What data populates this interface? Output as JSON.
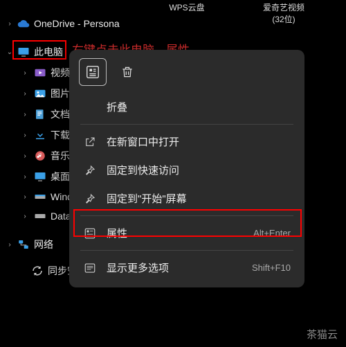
{
  "top_icons": {
    "wps": "WPS云盘",
    "iqiyi": "爱奇艺视频 (32位)"
  },
  "sidebar": {
    "onedrive": "OneDrive - Persona",
    "this_pc": "此电脑",
    "videos": "视频",
    "pictures": "图片",
    "documents": "文档",
    "downloads": "下载",
    "music": "音乐",
    "desktop": "桌面",
    "wind": "Wind",
    "data": "Data",
    "network": "网络",
    "sync": "同步空间"
  },
  "annotation": "右键点击此电脑、属性",
  "menu": {
    "collapse": "折叠",
    "open_new_window": "在新窗口中打开",
    "pin_quick_access": "固定到快速访问",
    "pin_start": "固定到\"开始\"屏幕",
    "properties": "属性",
    "properties_shortcut": "Alt+Enter",
    "show_more": "显示更多选项",
    "show_more_shortcut": "Shift+F10"
  },
  "watermark": "茶猫云"
}
